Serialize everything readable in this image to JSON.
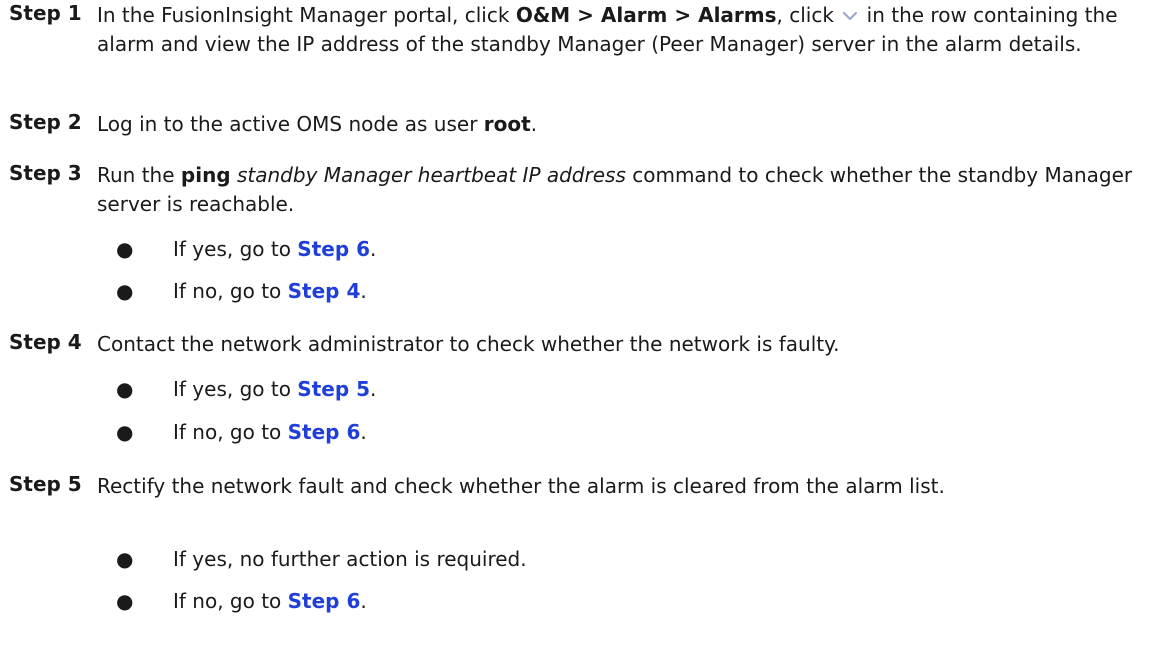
{
  "steps": [
    {
      "label": "Step 1",
      "parts": {
        "t1": "In the FusionInsight Manager portal, click ",
        "menu1": "O&M",
        "sep1": " > ",
        "menu2": "Alarm",
        "sep2": " > ",
        "menu3": "Alarms",
        "t2": ", click ",
        "t3": " in the row containing the alarm and view the IP address of the standby Manager (Peer Manager) server in the alarm details."
      },
      "icon": "chevron-down-icon"
    },
    {
      "label": "Step 2",
      "parts": {
        "t1": "Log in to the active OMS node as user ",
        "user": "root",
        "t2": "."
      }
    },
    {
      "label": "Step 3",
      "parts": {
        "t1": "Run the ",
        "cmd": "ping",
        "t2": " ",
        "arg": "standby Manager heartbeat IP address",
        "t3": " command to check whether the standby Manager server is reachable."
      },
      "bullets": [
        {
          "dot": "●",
          "prefix": "If yes, go to ",
          "link": "Step 6",
          "suffix": "."
        },
        {
          "dot": "●",
          "prefix": "If no, go to ",
          "link": "Step 4",
          "suffix": "."
        }
      ]
    },
    {
      "label": "Step 4",
      "parts": {
        "t1": "Contact the network administrator to check whether the network is faulty."
      },
      "bullets": [
        {
          "dot": "●",
          "prefix": "If yes, go to ",
          "link": "Step 5",
          "suffix": "."
        },
        {
          "dot": "●",
          "prefix": "If no, go to ",
          "link": "Step 6",
          "suffix": "."
        }
      ]
    },
    {
      "label": "Step 5",
      "parts": {
        "t1": "Rectify the network fault and check whether the alarm is cleared from the alarm list."
      },
      "bullets": [
        {
          "dot": "●",
          "text": "If yes, no further action is required."
        },
        {
          "dot": "●",
          "prefix": "If no, go to ",
          "link": "Step 6",
          "suffix": "."
        }
      ]
    }
  ],
  "colors": {
    "text": "#1a1a1a",
    "link": "#1f3fd8",
    "icon": "#9ea7d6"
  }
}
